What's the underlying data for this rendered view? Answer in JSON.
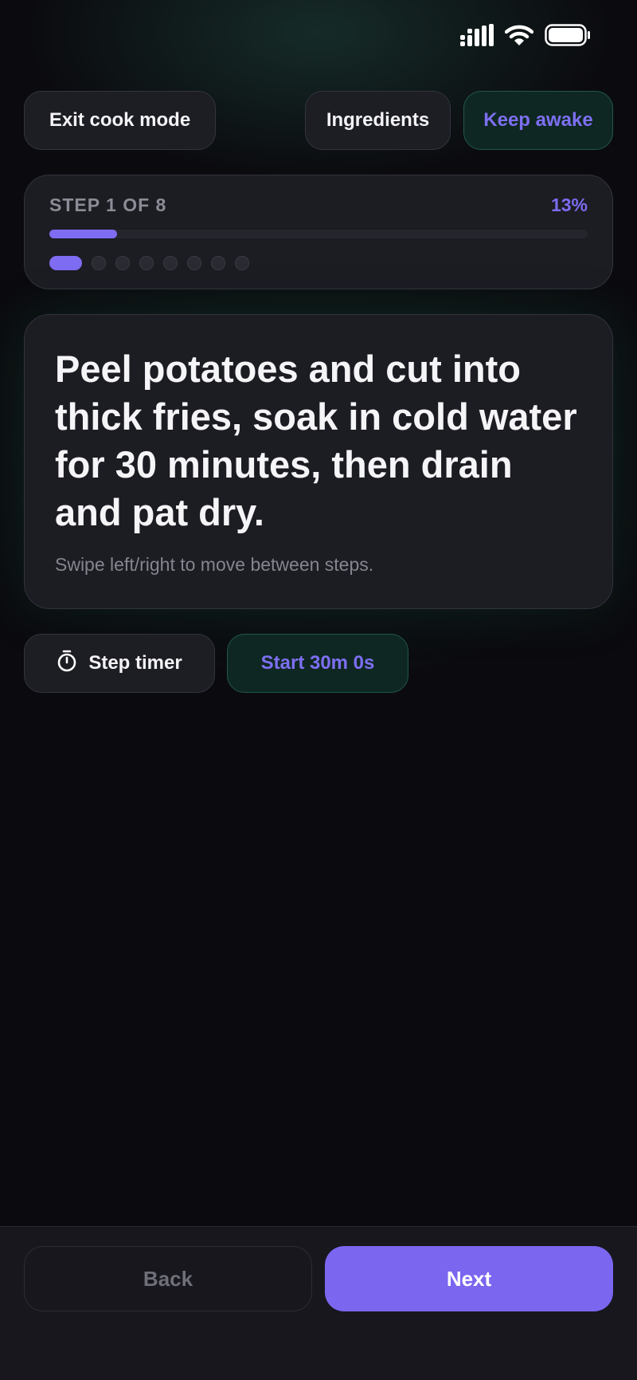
{
  "status_bar": {
    "icons": [
      "signal-icon",
      "wifi-icon",
      "battery-icon"
    ]
  },
  "header": {
    "exit_label": "Exit cook mode",
    "ingredients_label": "Ingredients",
    "keep_awake_label": "Keep awake"
  },
  "progress": {
    "step_label": "STEP 1 OF 8",
    "percent_label": "13%",
    "fraction": 0.125,
    "current_step": 1,
    "total_steps": 8
  },
  "step": {
    "instruction": "Peel potatoes and cut into thick fries, soak in cold water for 30 minutes, then drain and pat dry.",
    "hint": "Swipe left/right to move between steps."
  },
  "timer": {
    "label": "Step timer",
    "icon": "stopwatch-icon",
    "start_label": "Start 30m 0s"
  },
  "footer": {
    "back_label": "Back",
    "next_label": "Next"
  },
  "colors": {
    "accent": "#7b66f0",
    "background": "#0b0b0f",
    "card": "#1c1c23",
    "green_pill": "#0f2722"
  }
}
